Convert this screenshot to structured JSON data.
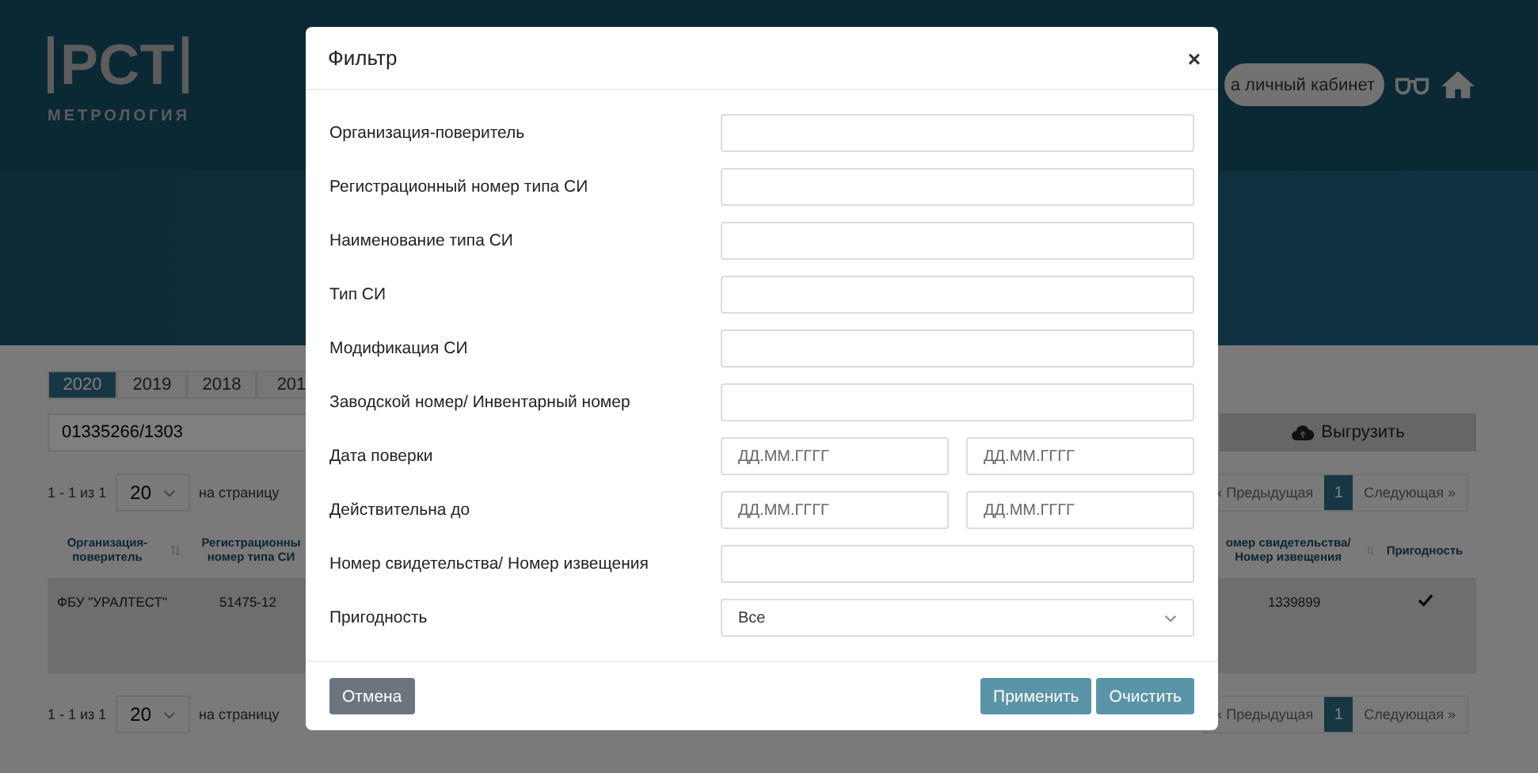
{
  "header": {
    "logo": "РСТ",
    "logo_subtitle": "МЕТРОЛОГИЯ",
    "account_button": "а личный кабинет"
  },
  "year_tabs": [
    {
      "label": "2020",
      "selected": true
    },
    {
      "label": "2019",
      "selected": false
    },
    {
      "label": "2018",
      "selected": false
    },
    {
      "label": "201",
      "selected": false
    }
  ],
  "search": {
    "value": "01335266/1303"
  },
  "export_button": "Выгрузить",
  "pagination_top": {
    "range": "1 - 1 из 1",
    "page_size": "20",
    "page_size_label": "на страницу",
    "prev": "« Предыдущая",
    "pages": [
      {
        "label": "1",
        "selected": true
      }
    ],
    "next": "Следующая »"
  },
  "table": {
    "columns": [
      {
        "label": "Организация-поверитель",
        "sortable": true
      },
      {
        "label": "Регистрационны номер типа СИ",
        "sortable": false
      },
      {
        "label": "омер свидетельства/ Номер извещения",
        "sortable": true
      },
      {
        "label": "Пригодность",
        "sortable": false
      }
    ],
    "rows": [
      {
        "organization": "ФБУ \"УРАЛТЕСТ\"",
        "reg_number": "51475-12",
        "certificate": "1339899",
        "suitable": true
      }
    ]
  },
  "pagination_bottom": {
    "range": "1 - 1 из 1",
    "page_size": "20",
    "page_size_label": "на страницу",
    "prev": "« Предыдущая",
    "pages": [
      {
        "label": "1",
        "selected": true
      }
    ],
    "next": "Следующая »"
  },
  "filter_dialog": {
    "title": "Фильтр",
    "close": "×",
    "fields": [
      {
        "kind": "text",
        "label": "Организация-поверитель"
      },
      {
        "kind": "text",
        "label": "Регистрационный номер типа СИ"
      },
      {
        "kind": "text",
        "label": "Наименование типа СИ"
      },
      {
        "kind": "text",
        "label": "Тип СИ"
      },
      {
        "kind": "text",
        "label": "Модификация СИ"
      },
      {
        "kind": "text",
        "label": "Заводской номер/ Инвентарный номер"
      },
      {
        "kind": "date_range",
        "label": "Дата поверки",
        "placeholders": [
          "ДД.ММ.ГГГГ",
          "ДД.ММ.ГГГГ"
        ]
      },
      {
        "kind": "date_range",
        "label": "Действительна до",
        "placeholders": [
          "ДД.ММ.ГГГГ",
          "ДД.ММ.ГГГГ"
        ]
      },
      {
        "kind": "text",
        "label": "Номер свидетельства/ Номер извещения"
      },
      {
        "kind": "select",
        "label": "Пригодность",
        "value": "Все"
      }
    ],
    "cancel_button": "Отмена",
    "apply_button": "Применить",
    "clear_button": "Очистить"
  }
}
